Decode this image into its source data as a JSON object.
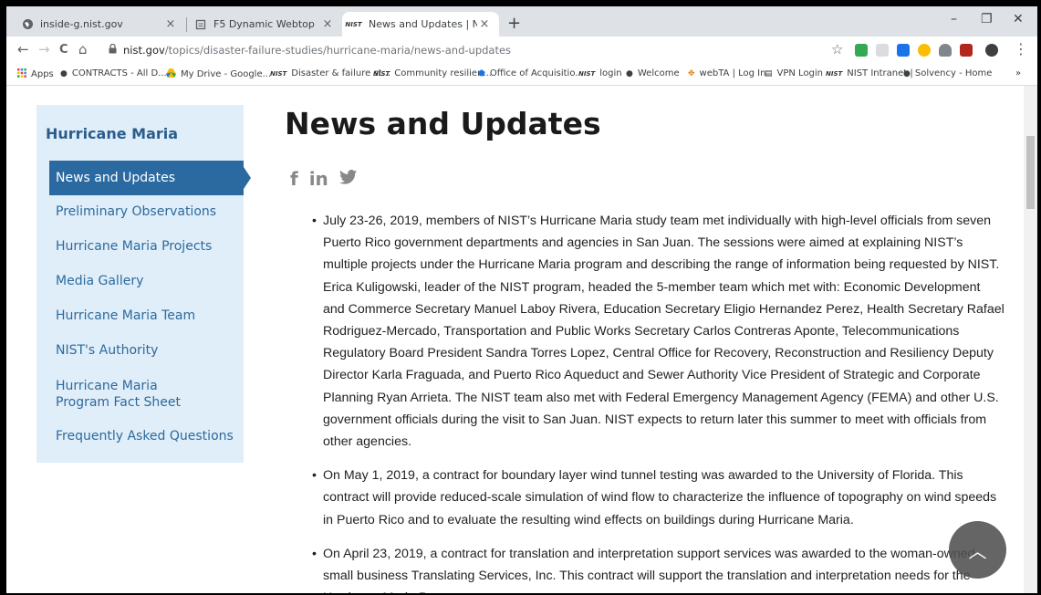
{
  "tabs": [
    {
      "title": "inside-g.nist.gov",
      "icon": "globe-icon"
    },
    {
      "title": "F5 Dynamic Webtop",
      "icon": "document-icon"
    },
    {
      "title": "News and Updates | NIST",
      "icon": "nist-icon"
    }
  ],
  "tab_close": "×",
  "new_tab": "+",
  "window_controls": {
    "minimize": "–",
    "restore": "❐",
    "close": "✕"
  },
  "address": {
    "domain": "nist.gov",
    "path": "/topics/disaster-failure-studies/hurricane-maria/news-and-updates"
  },
  "nav_glyphs": {
    "back": "←",
    "forward": "→",
    "reload": "C",
    "home": "⌂",
    "star": "☆",
    "menu": "⋮",
    "more": "»"
  },
  "bookmarks": [
    {
      "label": "Apps",
      "icon": "apps-grid-icon"
    },
    {
      "label": "CONTRACTS - All D...",
      "icon": "globe-icon"
    },
    {
      "label": "My Drive - Google...",
      "icon": "drive-icon"
    },
    {
      "label": "Disaster & failure st...",
      "icon": "nist-icon"
    },
    {
      "label": "Community resilien...",
      "icon": "nist-icon"
    },
    {
      "label": "Office of Acquisitio...",
      "icon": "shield-icon"
    },
    {
      "label": "login",
      "icon": "nist-icon"
    },
    {
      "label": "Welcome",
      "icon": "globe-icon"
    },
    {
      "label": "webTA | Log In",
      "icon": "webta-icon"
    },
    {
      "label": "VPN Login",
      "icon": "document-icon"
    },
    {
      "label": "NIST Intranet |",
      "icon": "nist-icon"
    },
    {
      "label": "Solvency - Home",
      "icon": "globe-icon"
    }
  ],
  "nist_mark": "NIST",
  "sidebar": {
    "title": "Hurricane Maria",
    "items": [
      {
        "label": "News and Updates",
        "active": true
      },
      {
        "label": "Preliminary Observations"
      },
      {
        "label": "Hurricane Maria Projects"
      },
      {
        "label": "Media Gallery"
      },
      {
        "label": "Hurricane Maria Team"
      },
      {
        "label": "NIST's Authority"
      },
      {
        "label": "Hurricane Maria Program Fact Sheet"
      },
      {
        "label": "Frequently Asked Questions"
      }
    ]
  },
  "page_title": "News and Updates",
  "social": {
    "facebook": "f",
    "linkedin": "in",
    "twitter": "🐦"
  },
  "news": [
    "July 23-26, 2019, members of NIST’s Hurricane Maria study team met individually with high-level officials from seven Puerto Rico government departments and agencies in San Juan. The sessions were aimed at explaining NIST’s multiple projects under the Hurricane Maria program and describing the range of information being requested by NIST. Erica Kuligowski, leader of the NIST program, headed the 5-member team which met with: Economic Development and Commerce Secretary Manuel Laboy Rivera, Education Secretary Eligio Hernandez Perez, Health Secretary Rafael Rodriguez-Mercado, Transportation and Public Works Secretary Carlos Contreras Aponte, Telecommunications Regulatory Board President Sandra Torres Lopez, Central Office for Recovery, Reconstruction and Resiliency Deputy Director Karla Fraguada, and Puerto Rico Aqueduct and Sewer Authority Vice President of Strategic and Corporate Planning Ryan Arrieta. The NIST team also met with Federal Emergency Management Agency (FEMA) and other U.S. government officials during the visit to San Juan. NIST expects to return later this summer to meet with officials from other agencies.",
    "On May 1, 2019, a contract for boundary layer wind tunnel testing was awarded to the University of Florida. This contract will provide reduced-scale simulation of wind flow to characterize the influence of topography on wind speeds in Puerto Rico and to evaluate the resulting wind effects on buildings during Hurricane Maria.",
    "On April 23, 2019, a contract for translation and interpretation support services was awarded to the woman-owned small business Translating Services, Inc. This contract will support the translation and interpretation needs for the Hurricane Maria Program."
  ],
  "back_to_top": "︿"
}
